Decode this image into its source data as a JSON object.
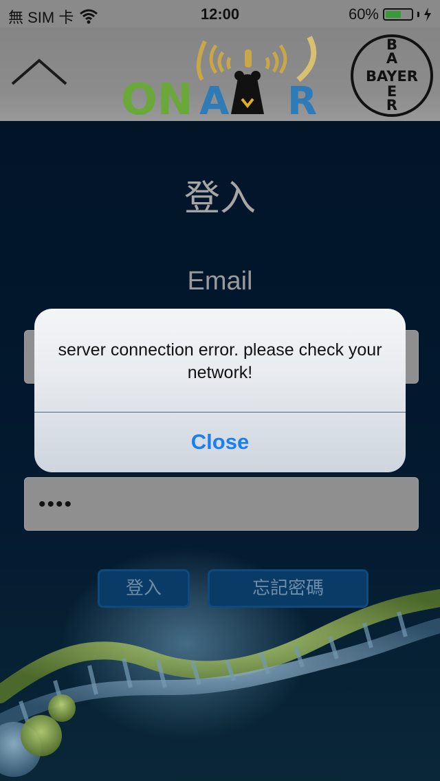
{
  "status_bar": {
    "carrier": "無 SIM 卡",
    "time": "12:00",
    "battery_text": "60%",
    "battery_level": 0.6
  },
  "nav": {
    "logo_on": "ON",
    "logo_air_a": "A",
    "logo_air_r": "R",
    "brand": "BAYER"
  },
  "page": {
    "title": "登入",
    "email_label": "Email",
    "password_value": "••••",
    "login_button": "登入",
    "forgot_button": "忘記密碼"
  },
  "alert": {
    "message": "server connection error. please check your network!",
    "close_label": "Close"
  },
  "colors": {
    "accent": "#1a7ff0",
    "background": "#021428",
    "battery": "#3a9a3a"
  }
}
